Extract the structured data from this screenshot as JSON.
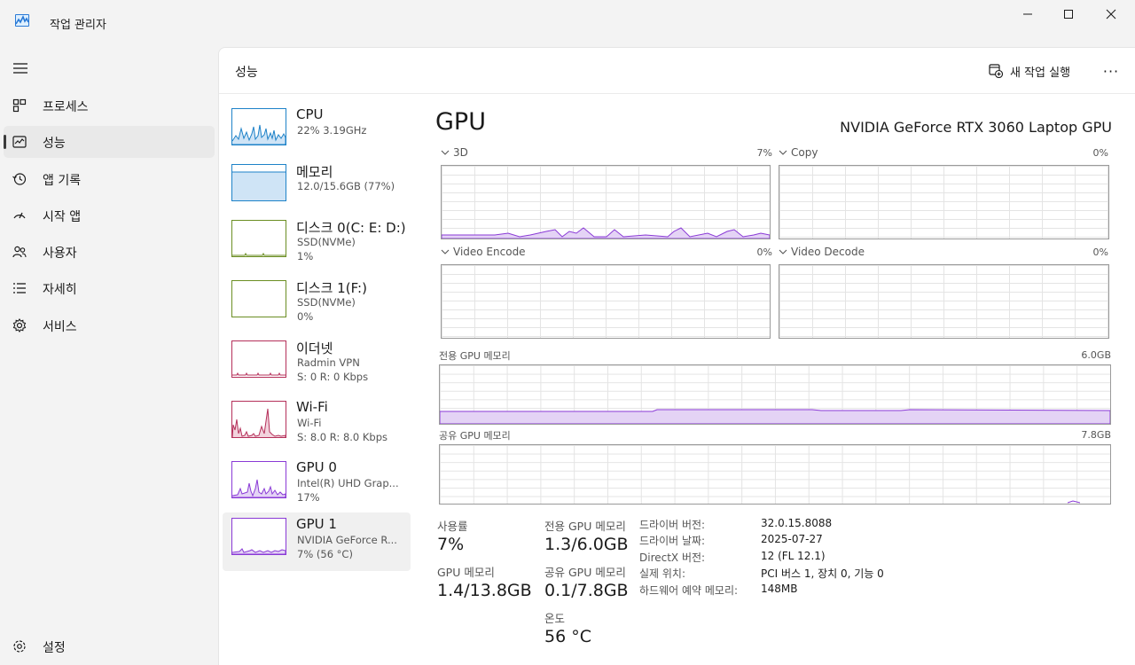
{
  "app": {
    "title": "작업 관리자"
  },
  "nav": {
    "items": [
      {
        "label": "프로세스",
        "icon": "processes-icon"
      },
      {
        "label": "성능",
        "icon": "performance-icon"
      },
      {
        "label": "앱 기록",
        "icon": "history-icon"
      },
      {
        "label": "시작 앱",
        "icon": "startup-icon"
      },
      {
        "label": "사용자",
        "icon": "users-icon"
      },
      {
        "label": "자세히",
        "icon": "details-icon"
      },
      {
        "label": "서비스",
        "icon": "services-icon"
      }
    ],
    "settings": "설정"
  },
  "header": {
    "title": "성능",
    "run_task": "새 작업 실행",
    "more": "···"
  },
  "devices": [
    {
      "name": "CPU",
      "sub1": "22% 3.19GHz",
      "sub2": "",
      "color": "#1e82c8"
    },
    {
      "name": "메모리",
      "sub1": "12.0/15.6GB (77%)",
      "sub2": "",
      "color": "#1e82c8"
    },
    {
      "name": "디스크 0(C: E: D:)",
      "sub1": "SSD(NVMe)",
      "sub2": "1%",
      "color": "#6b8e23"
    },
    {
      "name": "디스크 1(F:)",
      "sub1": "SSD(NVMe)",
      "sub2": "0%",
      "color": "#6b8e23"
    },
    {
      "name": "이더넷",
      "sub1": "Radmin VPN",
      "sub2": "S: 0 R: 0 Kbps",
      "color": "#b5305a"
    },
    {
      "name": "Wi-Fi",
      "sub1": "Wi-Fi",
      "sub2": "S: 8.0 R: 8.0 Kbps",
      "color": "#b5305a"
    },
    {
      "name": "GPU 0",
      "sub1": "Intel(R) UHD Grap...",
      "sub2": "17%",
      "color": "#8a3ad6"
    },
    {
      "name": "GPU 1",
      "sub1": "NVIDIA GeForce R...",
      "sub2": "7% (56 °C)",
      "color": "#8a3ad6"
    }
  ],
  "detail": {
    "title": "GPU",
    "model": "NVIDIA GeForce RTX 3060 Laptop GPU",
    "engines": [
      {
        "label": "3D",
        "pct": "7%"
      },
      {
        "label": "Copy",
        "pct": "0%"
      },
      {
        "label": "Video Encode",
        "pct": "0%"
      },
      {
        "label": "Video Decode",
        "pct": "0%"
      }
    ],
    "dedicated_label": "전용 GPU 메모리",
    "dedicated_max": "6.0GB",
    "shared_label": "공유 GPU 메모리",
    "shared_max": "7.8GB",
    "accent": "#8a3ad6"
  },
  "stats": {
    "usage_label": "사용률",
    "usage_value": "7%",
    "gpu_mem_label": "GPU 메모리",
    "gpu_mem_value": "1.4/13.8GB",
    "ded_label": "전용 GPU 메모리",
    "ded_value": "1.3/6.0GB",
    "shared_label": "공유 GPU 메모리",
    "shared_value": "0.1/7.8GB",
    "temp_label": "온도",
    "temp_value": "56 °C"
  },
  "info": [
    {
      "k": "드라이버 버전:",
      "v": "32.0.15.8088"
    },
    {
      "k": "드라이버 날짜:",
      "v": "2025-07-27"
    },
    {
      "k": "DirectX 버전:",
      "v": "12 (FL 12.1)"
    },
    {
      "k": "실제 위치:",
      "v": "PCI 버스 1, 장치 0, 기능 0"
    },
    {
      "k": "하드웨어 예약 메모리:",
      "v": "148MB"
    }
  ]
}
